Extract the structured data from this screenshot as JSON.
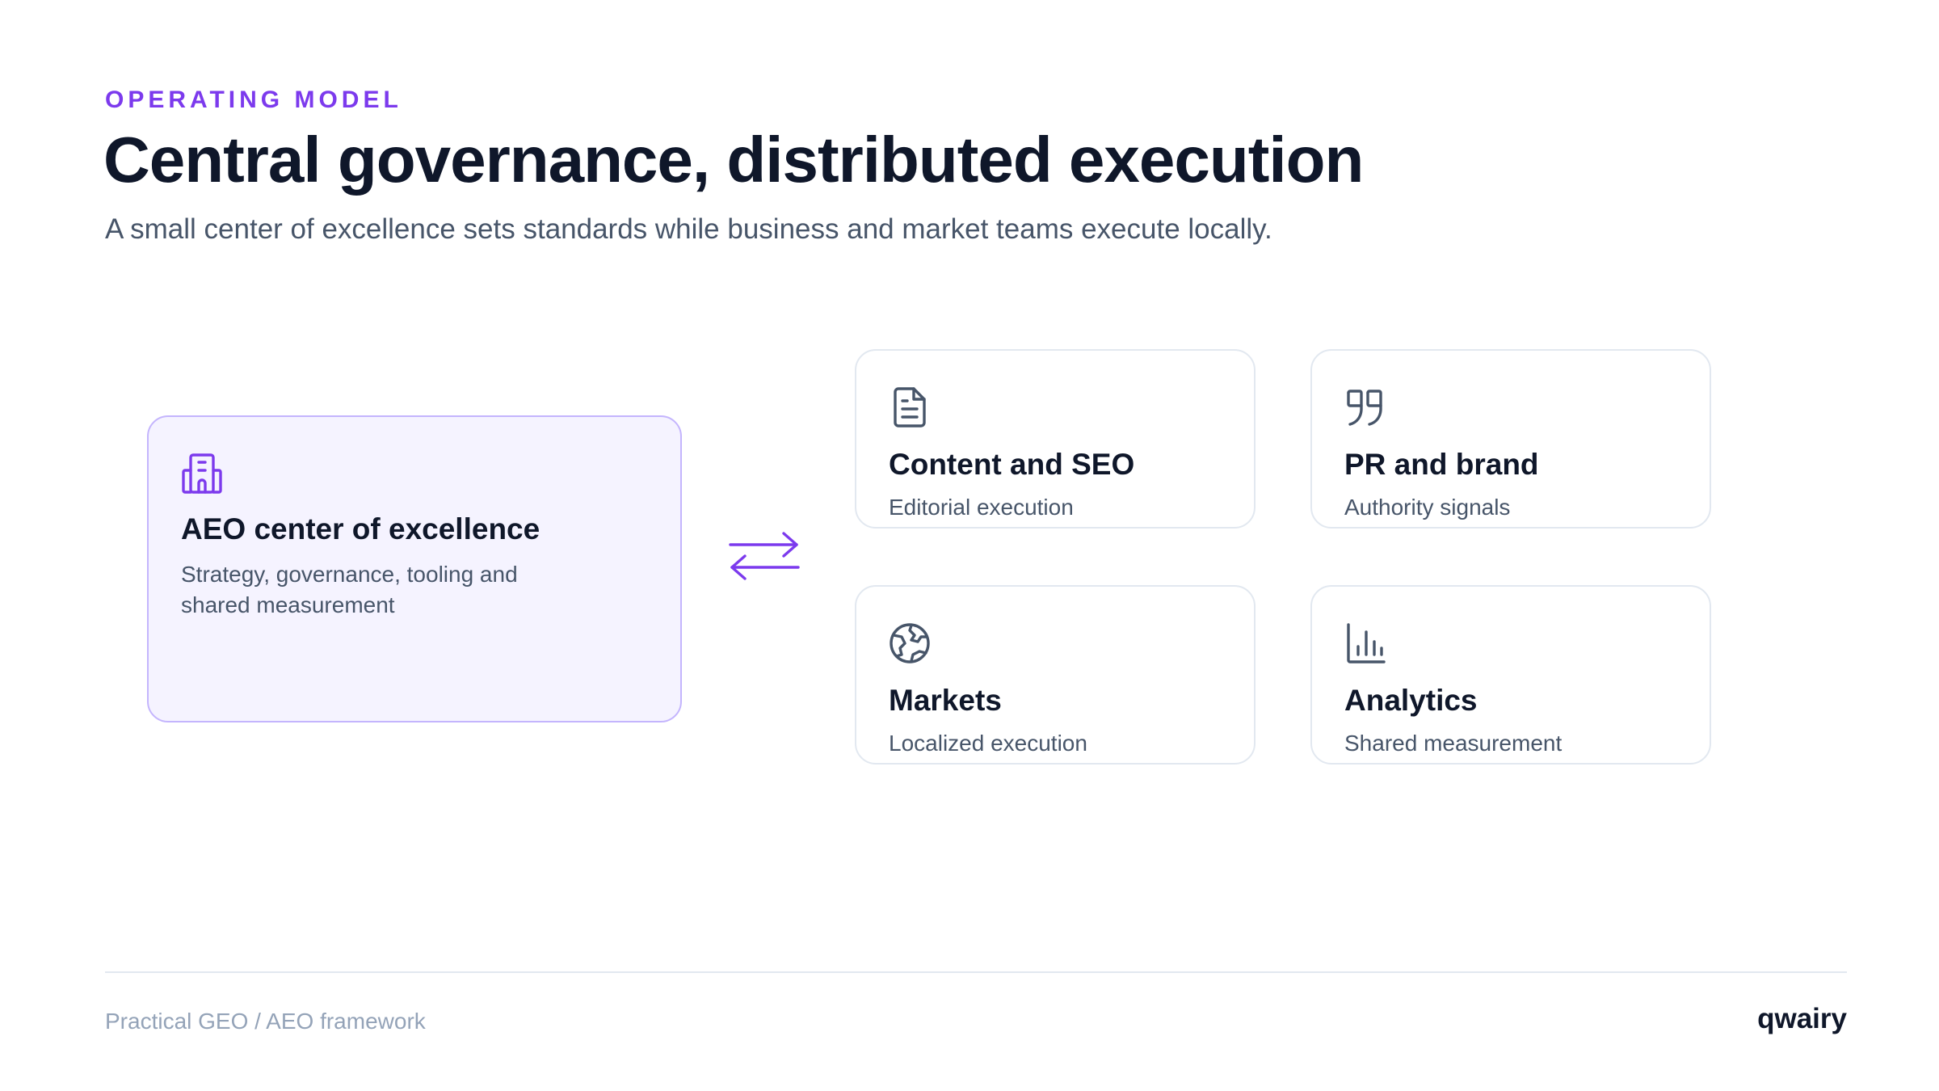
{
  "header": {
    "eyebrow": "OPERATING MODEL",
    "title": "Central governance, distributed execution",
    "subtitle": "A small center of excellence sets standards while business and market teams execute locally."
  },
  "hub": {
    "icon": "building-icon",
    "title": "AEO center of excellence",
    "description": "Strategy, governance, tooling and shared measurement"
  },
  "connector": {
    "icon": "exchange-arrows-icon"
  },
  "teams": [
    {
      "icon": "document-icon",
      "title": "Content and SEO",
      "description": "Editorial execution"
    },
    {
      "icon": "quote-icon",
      "title": "PR and brand",
      "description": "Authority signals"
    },
    {
      "icon": "globe-icon",
      "title": "Markets",
      "description": "Localized execution"
    },
    {
      "icon": "bar-chart-icon",
      "title": "Analytics",
      "description": "Shared measurement"
    }
  ],
  "footer": {
    "left": "Practical GEO / AEO framework",
    "brand": "qwairy"
  },
  "colors": {
    "accent": "#7c3aed",
    "hub_background": "#f5f3ff",
    "hub_border": "#c4b5fd",
    "card_border": "#e2e8f0",
    "title_text": "#0f172a",
    "body_text": "#475569",
    "muted_text": "#94a3b8",
    "icon_stroke": "#475569"
  }
}
